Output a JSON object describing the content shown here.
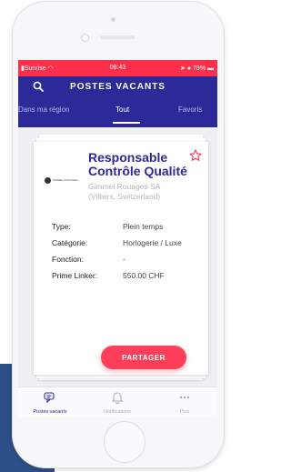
{
  "colors": {
    "header_bg": "#2b2a98",
    "status_bar": "#ff2f4a",
    "accent": "#ff3f5a",
    "title_text": "#2b2a98"
  },
  "status_bar": {
    "carrier": "Sunrise",
    "time": "08:43",
    "battery": "79%"
  },
  "header": {
    "title": "POSTES VACANTS",
    "search_icon": "search-icon"
  },
  "tabs": [
    {
      "label": "Dans ma région",
      "active": false
    },
    {
      "label": "Tout",
      "active": true
    },
    {
      "label": "Favoris",
      "active": false
    }
  ],
  "job": {
    "title": "Responsable Contrôle Qualité",
    "company": "Gimmel Rouages SA",
    "location": "(Villiers,  Switzerland)",
    "logo_text": "GIMMEL ROUAGES",
    "favorite_icon": "star-outline-icon",
    "details": [
      {
        "label": "Type:",
        "value": "Plein temps"
      },
      {
        "label": "Catégorie:",
        "value": "Horlogerie / Luxe"
      },
      {
        "label": "Fonction:",
        "value": "-"
      },
      {
        "label": "Prime Linker:",
        "value": "550.00 CHF"
      }
    ],
    "share_label": "PARTAGER"
  },
  "bottom_nav": [
    {
      "label": "Postes vacants",
      "icon": "chat-bubbles-icon",
      "active": true
    },
    {
      "label": "Notifications",
      "icon": "bell-icon",
      "active": false
    },
    {
      "label": "Plus",
      "icon": "more-dots-icon",
      "active": false
    }
  ]
}
